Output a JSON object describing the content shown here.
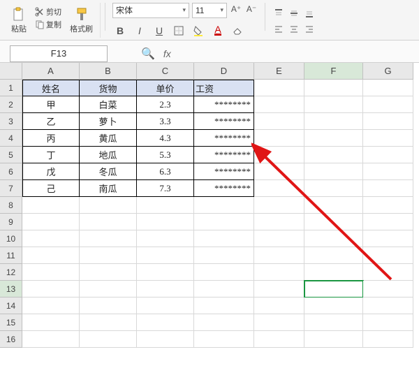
{
  "ribbon": {
    "paste_label": "粘贴",
    "cut_label": "剪切",
    "copy_label": "复制",
    "format_painter_label": "格式刷",
    "font_name": "宋体",
    "font_size": "11"
  },
  "name_box": {
    "value": "F13"
  },
  "formula_bar": {
    "fx_label": "fx"
  },
  "columns": [
    "A",
    "B",
    "C",
    "D",
    "E",
    "F",
    "G"
  ],
  "column_widths": {
    "A": 82,
    "B": 82,
    "C": 82,
    "D": 86,
    "E": 72,
    "F": 84,
    "G": 72
  },
  "row_numbers": [
    1,
    2,
    3,
    4,
    5,
    6,
    7,
    8,
    9,
    10,
    11,
    12,
    13,
    14,
    15,
    16
  ],
  "active_cell": {
    "col": "F",
    "row": 13
  },
  "table": {
    "header": {
      "A": "姓名",
      "B": "货物",
      "C": "单价",
      "D": "工资"
    },
    "rows": [
      {
        "A": "甲",
        "B": "白菜",
        "C": "2.3",
        "D": "********"
      },
      {
        "A": "乙",
        "B": "萝卜",
        "C": "3.3",
        "D": "********"
      },
      {
        "A": "丙",
        "B": "黄瓜",
        "C": "4.3",
        "D": "********"
      },
      {
        "A": "丁",
        "B": "地瓜",
        "C": "5.3",
        "D": "********"
      },
      {
        "A": "戊",
        "B": "冬瓜",
        "C": "6.3",
        "D": "********"
      },
      {
        "A": "己",
        "B": "南瓜",
        "C": "7.3",
        "D": "********"
      }
    ]
  }
}
